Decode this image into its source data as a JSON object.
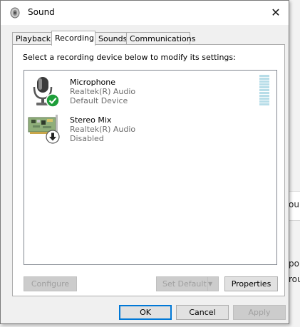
{
  "window": {
    "title": "Sound",
    "close_glyph": "✕"
  },
  "tabs": [
    {
      "label": "Playback"
    },
    {
      "label": "Recording",
      "active": true
    },
    {
      "label": "Sounds"
    },
    {
      "label": "Communications"
    }
  ],
  "panel": {
    "instruction": "Select a recording device below to modify its settings:",
    "devices": [
      {
        "name": "Microphone",
        "driver": "Realtek(R) Audio",
        "status": "Default Device",
        "icon": "microphone-icon",
        "badge": "green-check-icon"
      },
      {
        "name": "Stereo Mix",
        "driver": "Realtek(R) Audio",
        "status": "Disabled",
        "icon": "sound-card-icon",
        "badge": "disabled-arrow-icon"
      }
    ],
    "buttons": {
      "configure": "Configure",
      "set_default": "Set Default",
      "properties": "Properties"
    }
  },
  "footer": {
    "ok": "OK",
    "cancel": "Cancel",
    "apply": "Apply"
  },
  "background": {
    "text1": "ou",
    "text2": "po",
    "text3": "rou"
  },
  "colors": {
    "meter": "#b7dde8",
    "check": "#1e9e3a",
    "focus": "#0078d7"
  }
}
